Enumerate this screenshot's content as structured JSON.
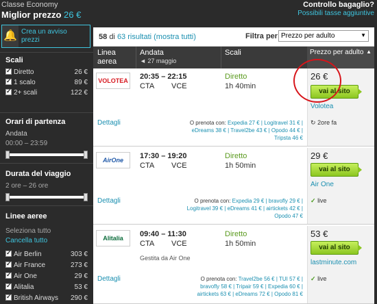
{
  "header": {
    "class_label": "Classe Economy",
    "best_price_label": "Miglior prezzo",
    "best_price_value": "26 €",
    "baggage_label": "Controllo bagaglio?",
    "taxes_link": "Possibili tasse aggiuntive"
  },
  "sidebar": {
    "alert_text_1": "Crea un avviso",
    "alert_text_2": "prezzi",
    "stops_title": "Scali",
    "stops": [
      {
        "label": "Diretto",
        "price": "26 €"
      },
      {
        "label": "1 scalo",
        "price": "89 €"
      },
      {
        "label": "2+ scali",
        "price": "122 €"
      }
    ],
    "departure_title": "Orari di partenza",
    "departure_sub": "Andata",
    "departure_range": "00:00 – 23:59",
    "duration_title": "Durata del viaggio",
    "duration_range": "2 ore – 26 ore",
    "airlines_title": "Linee aeree",
    "select_all": "Seleziona tutto",
    "clear_all": "Cancella tutto",
    "airlines": [
      {
        "label": "Air Berlin",
        "price": "303 €"
      },
      {
        "label": "Air France",
        "price": "273 €"
      },
      {
        "label": "Air One",
        "price": "29 €"
      },
      {
        "label": "Alitalia",
        "price": "53 €"
      },
      {
        "label": "British Airways",
        "price": "290 €"
      }
    ]
  },
  "results": {
    "shown": "58",
    "of_word": "di",
    "total": "63 risultati",
    "show_all": "(mostra tutti)",
    "filter_label": "Filtra per",
    "filter_value": "Prezzo per adulto"
  },
  "table_header": {
    "airline_1": "Linea",
    "airline_2": "aerea",
    "outbound": "Andata",
    "outbound_date": "◄ 27 maggio",
    "stops": "Scali",
    "price": "Prezzo per adulto",
    "sort_icon": "▲"
  },
  "flights": [
    {
      "logo": "VOLOTEA",
      "dep_time": "20:35",
      "arr_time": "22:15",
      "dep_code": "CTA",
      "arr_code": "VCE",
      "stops": "Diretto",
      "duration": "1h 40min",
      "note": "",
      "details": "Dettagli",
      "alt_prefix": "O prenota con:",
      "alt_lines": [
        "Expedia 27 € | Logitravel 31 € |",
        "eDreams 38 € | Travel2be 43 € | Opodo 44 € |",
        "Tripsta 46 €"
      ],
      "price": "26 €",
      "button": "vai al sito",
      "provider": "Volotea",
      "status": "2ore fa",
      "status_icon": "↻"
    },
    {
      "logo": "AirOne",
      "dep_time": "17:30",
      "arr_time": "19:20",
      "dep_code": "CTA",
      "arr_code": "VCE",
      "stops": "Diretto",
      "duration": "1h 50min",
      "note": "",
      "details": "Dettagli",
      "alt_prefix": "O prenota con:",
      "alt_lines": [
        "Expedia 29 € | bravofly 29 € |",
        "Logitravel 39 € | eDreams 41 € | airtickets 42 € |",
        "Opodo 47 €"
      ],
      "price": "29 €",
      "button": "vai al sito",
      "provider": "Air One",
      "status": "live",
      "status_icon": "✓"
    },
    {
      "logo": "Alitalia",
      "dep_time": "09:40",
      "arr_time": "11:30",
      "dep_code": "CTA",
      "arr_code": "VCE",
      "stops": "Diretto",
      "duration": "1h 50min",
      "note": "Gestita da Air One",
      "details": "Dettagli",
      "alt_prefix": "O prenota con:",
      "alt_lines": [
        "Travel2be 56 € | TUI 57 € |",
        "bravofly 58 € | Tripair 59 € | Expedia 60 € |",
        "airtickets 63 € | eDreams 72 € | Opodo 81 €"
      ],
      "price": "53 €",
      "button": "vai al sito",
      "provider": "lastminute.com",
      "status": "live",
      "status_icon": "✓"
    }
  ],
  "colors": {
    "accent": "#3fc6e0",
    "link": "#1a8fb0",
    "direct": "#5a9a1e",
    "button": "#8cc621",
    "highlight_circle": "#d7141a"
  }
}
